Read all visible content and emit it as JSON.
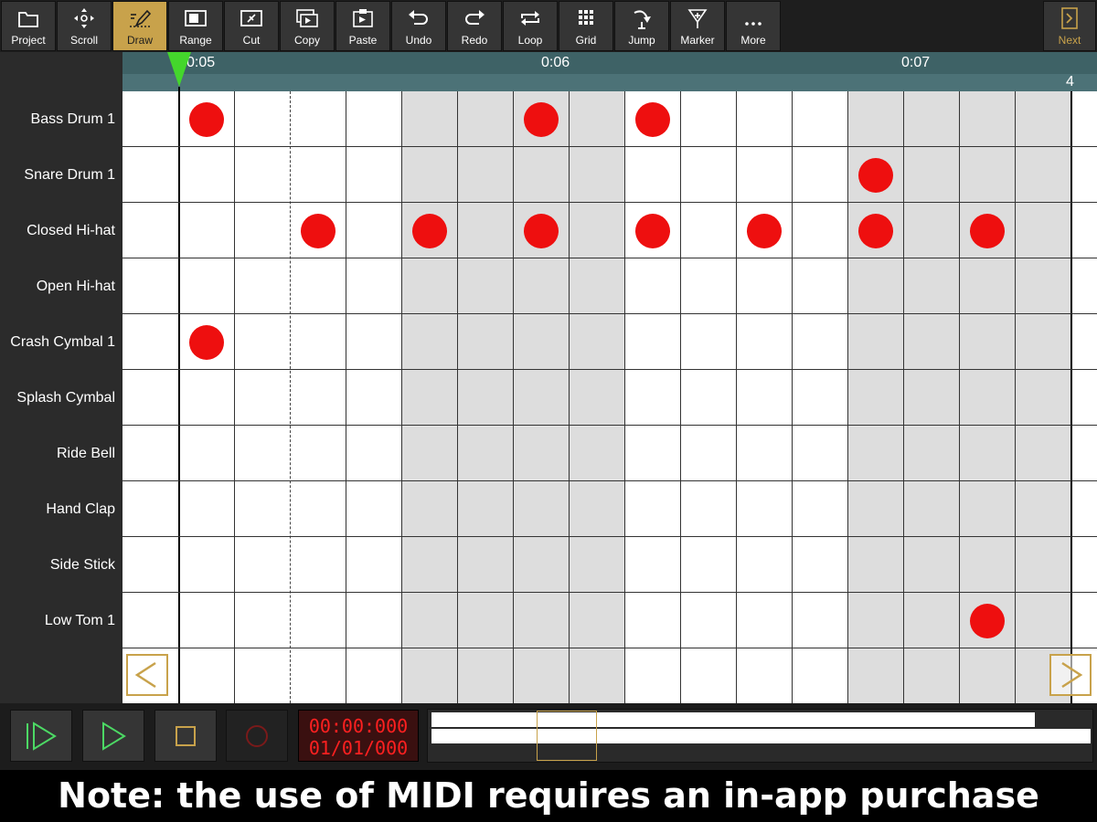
{
  "toolbar": {
    "tools": [
      {
        "label": "Project",
        "icon": "folder-icon"
      },
      {
        "label": "Scroll",
        "icon": "move-arrows-icon"
      },
      {
        "label": "Draw",
        "icon": "pencil-icon",
        "active": true
      },
      {
        "label": "Range",
        "icon": "range-icon"
      },
      {
        "label": "Cut",
        "icon": "scissors-icon"
      },
      {
        "label": "Copy",
        "icon": "copy-icon"
      },
      {
        "label": "Paste",
        "icon": "paste-icon"
      },
      {
        "label": "Undo",
        "icon": "undo-icon"
      },
      {
        "label": "Redo",
        "icon": "redo-icon"
      },
      {
        "label": "Loop",
        "icon": "loop-icon"
      },
      {
        "label": "Grid",
        "icon": "grid-icon"
      },
      {
        "label": "Jump",
        "icon": "jump-icon"
      },
      {
        "label": "Marker",
        "icon": "marker-icon"
      },
      {
        "label": "More",
        "icon": "more-dots-icon"
      }
    ],
    "next_label": "Next"
  },
  "timeline": {
    "ticks": [
      "0:05",
      "0:06",
      "0:07"
    ],
    "measure": "4"
  },
  "instruments": [
    "Bass Drum 1",
    "Snare Drum 1",
    "Closed Hi-hat",
    "Open Hi-hat",
    "Crash Cymbal 1",
    "Splash Cymbal",
    "Ride Bell",
    "Hand Clap",
    "Side Stick",
    "Low Tom 1"
  ],
  "notes": [
    {
      "row": 0,
      "step": 1
    },
    {
      "row": 0,
      "step": 7
    },
    {
      "row": 0,
      "step": 9
    },
    {
      "row": 1,
      "step": 13
    },
    {
      "row": 2,
      "step": 3
    },
    {
      "row": 2,
      "step": 5
    },
    {
      "row": 2,
      "step": 7
    },
    {
      "row": 2,
      "step": 9
    },
    {
      "row": 2,
      "step": 11
    },
    {
      "row": 2,
      "step": 13
    },
    {
      "row": 2,
      "step": 15
    },
    {
      "row": 4,
      "step": 1
    },
    {
      "row": 9,
      "step": 15
    }
  ],
  "transport": {
    "time": "00:00:000",
    "position": "01/01/000"
  },
  "caption": "Note: the use of MIDI requires an in-app purchase",
  "colors": {
    "accent": "#c8a24b",
    "note": "#ee0f0f",
    "timeline": "#3e6266",
    "counter_text": "#ff2020",
    "play": "#4cd964"
  }
}
